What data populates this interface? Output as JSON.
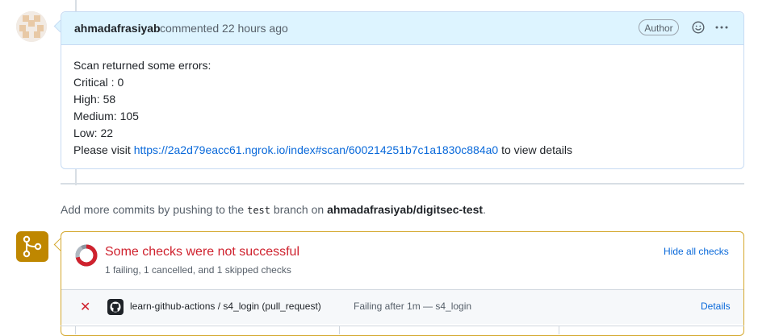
{
  "comment": {
    "author": "ahmadafrasiyab",
    "meta": "commented 22 hours ago",
    "badge": "Author",
    "lines": [
      "Scan returned some errors:",
      "Critical : 0",
      "High: 58",
      "Medium: 105",
      "Low: 22"
    ],
    "visit_prefix": "Please visit ",
    "visit_link": "https://2a2d79eacc61.ngrok.io/index#scan/600214251b7c1a1830c884a0",
    "visit_suffix": " to view details"
  },
  "push_note": {
    "prefix": "Add more commits by pushing to the ",
    "branch": "test",
    "middle": " branch on ",
    "repo": "ahmadafrasiyab/digitsec-test",
    "suffix": "."
  },
  "checks": {
    "title": "Some checks were not successful",
    "subtitle": "1 failing, 1 cancelled, and 1 skipped checks",
    "hide_label": "Hide all checks",
    "rows": [
      {
        "name": "learn-github-actions / s4_login (pull_request)",
        "status": "Failing after 1m — s4_login",
        "details": "Details"
      }
    ]
  },
  "icons": {
    "avatar": "avatar-identicon",
    "smiley": "smiley-icon",
    "kebab": "kebab-horizontal-icon",
    "merge": "git-merge-icon",
    "donut": "checks-status-donut-icon",
    "fail": "x-icon",
    "app": "github-mark-icon"
  },
  "colors": {
    "link": "#0969da",
    "danger": "#cf222e",
    "attention": "#bf8700",
    "comment_header": "#ddf4ff"
  }
}
